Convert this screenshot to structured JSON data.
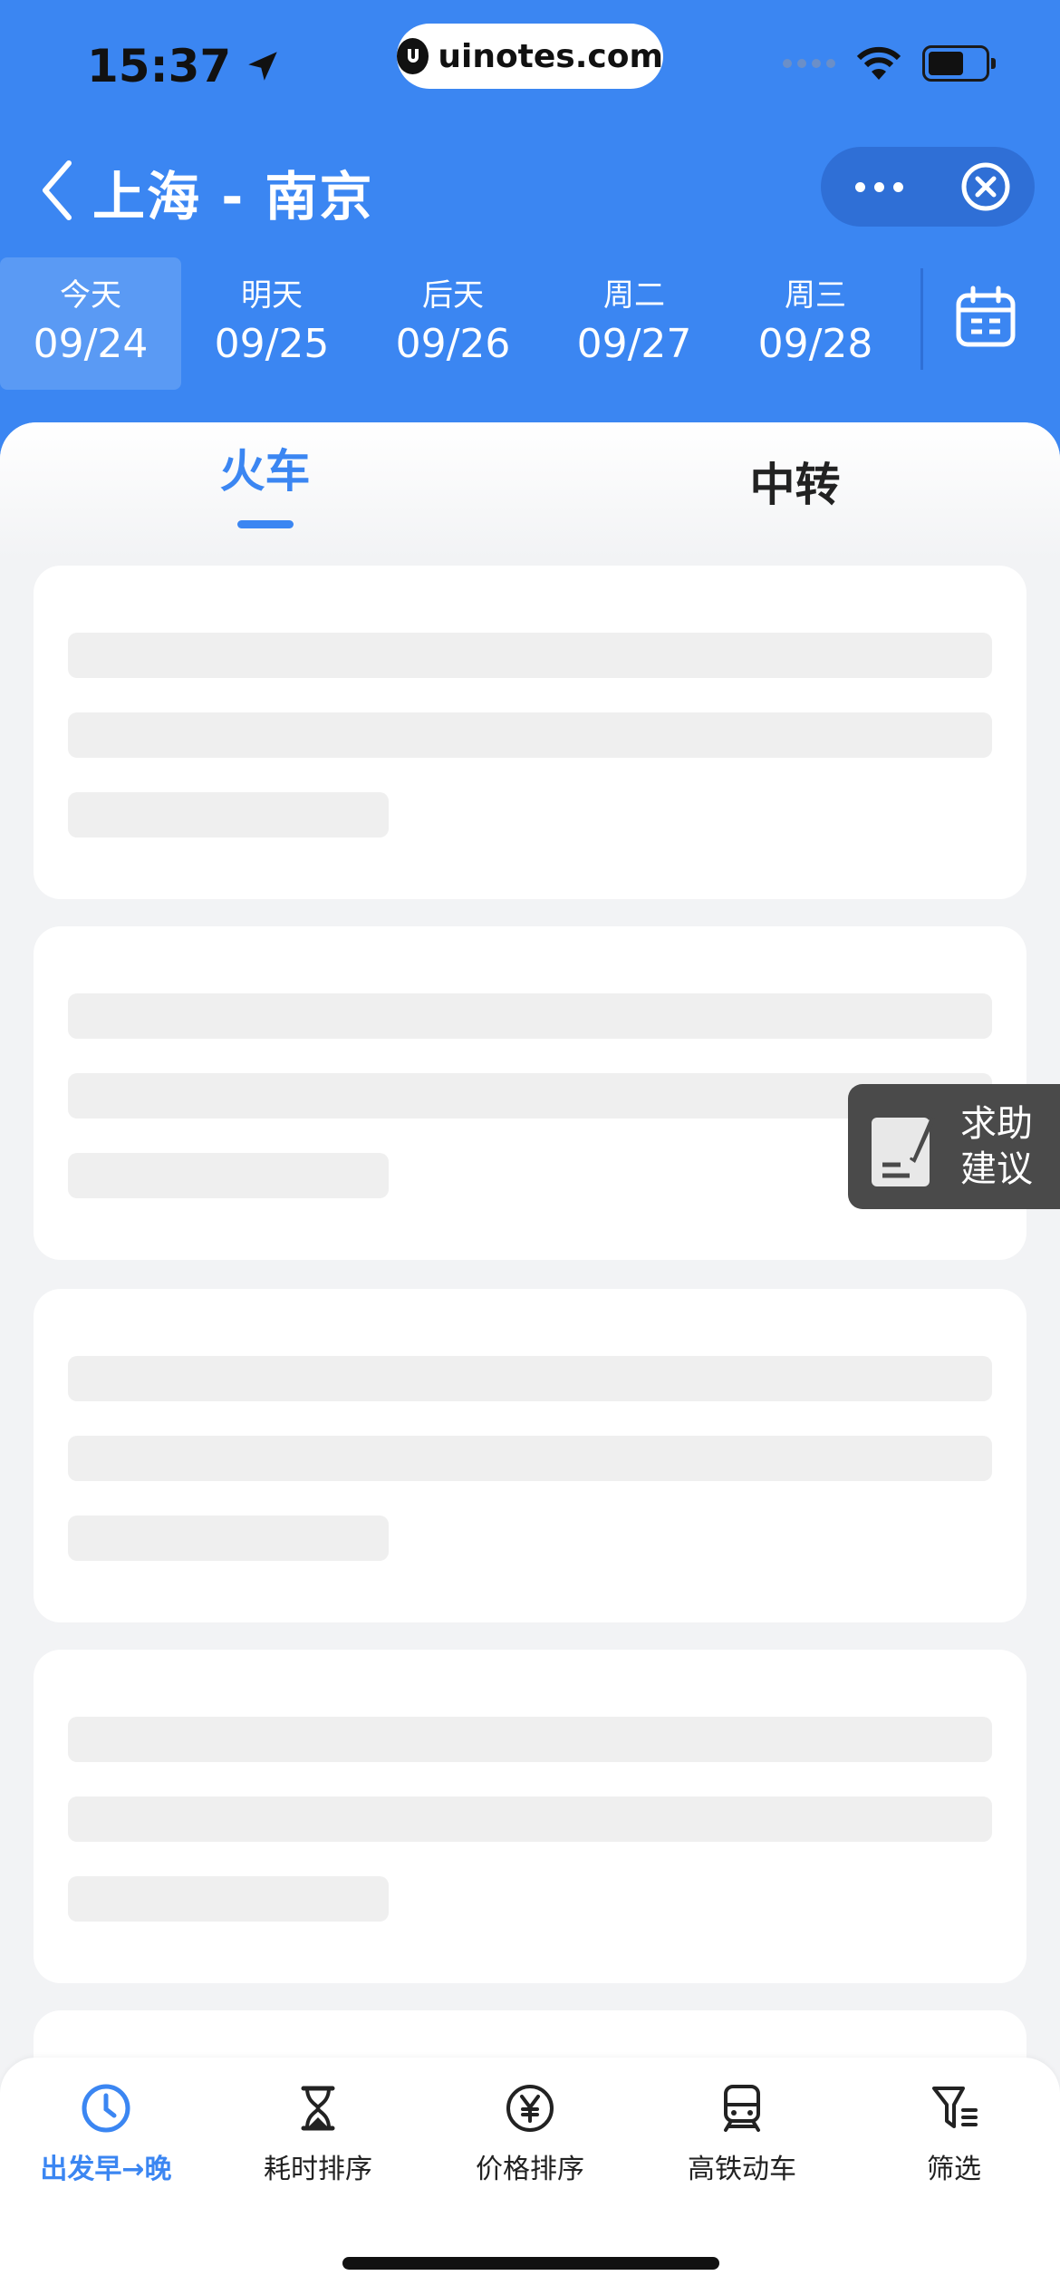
{
  "status_bar": {
    "time": "15:37",
    "watermark": "uinotes.com"
  },
  "nav": {
    "title": "上海 - 南京"
  },
  "dates": [
    {
      "day": "今天",
      "md": "09/24",
      "active": true
    },
    {
      "day": "明天",
      "md": "09/25"
    },
    {
      "day": "后天",
      "md": "09/26"
    },
    {
      "day": "周二",
      "md": "09/27"
    },
    {
      "day": "周三",
      "md": "09/28"
    }
  ],
  "tabs": [
    {
      "label": "火车",
      "active": true
    },
    {
      "label": "中转"
    }
  ],
  "feedback": {
    "label": "求助建议"
  },
  "bottom_bar": [
    {
      "label": "出发早→晚",
      "icon": "clock-icon",
      "active": true
    },
    {
      "label": "耗时排序",
      "icon": "hourglass-icon"
    },
    {
      "label": "价格排序",
      "icon": "yen-icon"
    },
    {
      "label": "高铁动车",
      "icon": "train-icon"
    },
    {
      "label": "筛选",
      "icon": "filter-icon"
    }
  ],
  "colors": {
    "primary": "#3b86f2",
    "background": "#f2f3f5",
    "skeleton": "#efefef"
  }
}
